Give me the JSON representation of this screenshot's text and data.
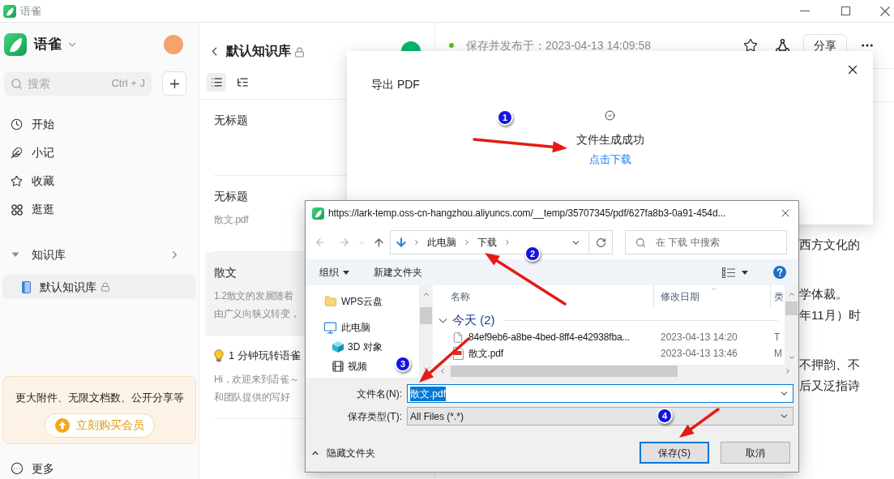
{
  "window": {
    "title": "语雀"
  },
  "sidebar": {
    "brand": "语雀",
    "search": {
      "placeholder": "搜索",
      "shortcut": "Ctrl + J"
    },
    "nav": [
      {
        "label": "开始"
      },
      {
        "label": "小记"
      },
      {
        "label": "收藏"
      },
      {
        "label": "逛逛"
      }
    ],
    "section": {
      "label": "知识库",
      "expanded": true
    },
    "books": [
      {
        "label": "默认知识库",
        "selected": true,
        "locked": true
      }
    ],
    "promo": {
      "text": "更大附件、无限文档数、公开分享等",
      "button": "立刻购买会员"
    },
    "more": "更多"
  },
  "list": {
    "title": "默认知识库",
    "locked": true,
    "views": [
      {
        "selected": true
      },
      {
        "selected": false
      }
    ],
    "docs": [
      {
        "kind": "doc",
        "title": "无标题",
        "selected": false
      },
      {
        "kind": "doc",
        "title": "无标题",
        "excerpt": [
          "散文.pdf"
        ],
        "selected": false
      },
      {
        "kind": "doc",
        "title": "散文",
        "excerpt": [
          "1.2散文的发展随着",
          "由广义向狭义转变，"
        ],
        "selected": true
      },
      {
        "kind": "guide",
        "title": "1 分钟玩转语雀",
        "excerpt": [
          "Hi，欢迎来到语雀～",
          "和团队提供的写好"
        ],
        "selected": false
      }
    ]
  },
  "document": {
    "status": "保存并发布于：2023-04-13 14:09:58",
    "share": "分享",
    "paragraphs": [
      [
        "西方文化的"
      ],
      [
        "学体裁。",
        "年11月）时"
      ],
      [
        "不押韵、不",
        "后又泛指诗"
      ]
    ]
  },
  "export_modal": {
    "title": "导出 PDF",
    "message": "文件生成成功",
    "link": "点击下载"
  },
  "save_dialog": {
    "title": "https://lark-temp.oss-cn-hangzhou.aliyuncs.com/__temp/35707345/pdf/627fa8b3-0a91-454d...",
    "breadcrumb": [
      "此电脑",
      "下载"
    ],
    "search": {
      "placeholder": "在 下载 中搜索"
    },
    "toolbar": {
      "organize": "组织",
      "new_folder": "新建文件夹"
    },
    "nav_pane": [
      {
        "label": "WPS云盘"
      },
      {
        "label": "此电脑",
        "children": [
          {
            "label": "3D 对象"
          },
          {
            "label": "视频"
          }
        ]
      }
    ],
    "columns": [
      "名称",
      "修改日期",
      "类"
    ],
    "groups": [
      {
        "label": "今天 (2)",
        "expanded": true,
        "files": [
          {
            "kind": "file",
            "name": "84ef9eb6-a8be-4bed-8ff4-e42938fba...",
            "date": "2023-04-13 14:20",
            "column_3": "T"
          },
          {
            "kind": "pdf",
            "name": "散文.pdf",
            "date": "2023-04-13 13:46",
            "column_3": "M"
          }
        ]
      }
    ],
    "filename": {
      "label": "文件名(N):",
      "value": "散文.pdf",
      "selected": true
    },
    "filetype": {
      "label": "保存类型(T):",
      "value": "All Files (*.*)"
    },
    "hide_folders": "隐藏文件夹",
    "buttons": [
      {
        "label": "保存(S)",
        "default": true
      },
      {
        "label": "取消",
        "default": false
      }
    ]
  },
  "annotations": [
    {
      "label": "1"
    },
    {
      "label": "2"
    },
    {
      "label": "3"
    },
    {
      "label": "4"
    }
  ]
}
